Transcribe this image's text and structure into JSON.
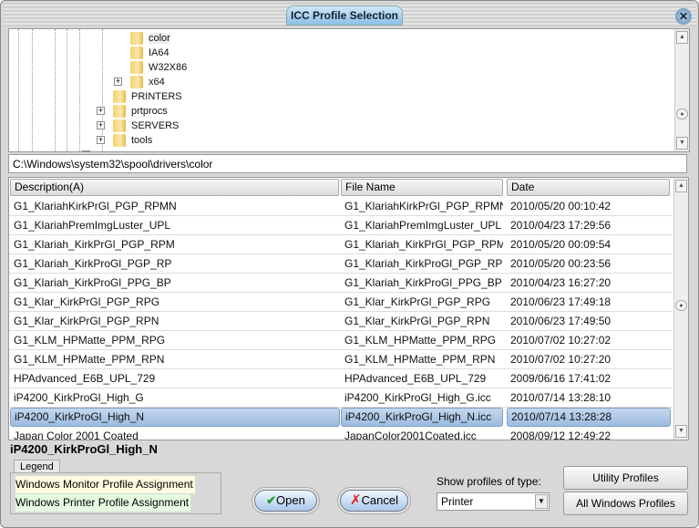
{
  "window": {
    "title": "ICC Profile Selection",
    "close_icon": "close-icon"
  },
  "tree": {
    "items": [
      {
        "label": "color",
        "expandable": false,
        "selected": true
      },
      {
        "label": "IA64",
        "expandable": false
      },
      {
        "label": "W32X86",
        "expandable": false
      },
      {
        "label": "x64",
        "expandable": true
      },
      {
        "label": "PRINTERS",
        "expandable": false
      },
      {
        "label": "prtprocs",
        "expandable": true
      },
      {
        "label": "SERVERS",
        "expandable": true
      },
      {
        "label": "tools",
        "expandable": true
      }
    ]
  },
  "path": "C:\\Windows\\system32\\spool\\drivers\\color",
  "table": {
    "columns": [
      "Description(A)",
      "File Name",
      "Date"
    ],
    "rows": [
      [
        "G1_KlariahKirkPrGl_PGP_RPMN",
        "G1_KlariahKirkPrGl_PGP_RPMN",
        "2010/05/20 00:10:42"
      ],
      [
        "G1_KlariahPremImgLuster_UPL",
        "G1_KlariahPremImgLuster_UPL",
        "2010/04/23 17:29:56"
      ],
      [
        "G1_Klariah_KirkPrGl_PGP_RPM",
        "G1_Klariah_KirkPrGl_PGP_RPM",
        "2010/05/20 00:09:54"
      ],
      [
        "G1_Klariah_KirkProGl_PGP_RP",
        "G1_Klariah_KirkProGl_PGP_RP",
        "2010/05/20 00:23:56"
      ],
      [
        "G1_Klariah_KirkProGl_PPG_BP",
        "G1_Klariah_KirkProGl_PPG_BP",
        "2010/04/23 16:27:20"
      ],
      [
        "G1_Klar_KirkPrGl_PGP_RPG",
        "G1_Klar_KirkPrGl_PGP_RPG",
        "2010/06/23 17:49:18"
      ],
      [
        "G1_Klar_KirkPrGl_PGP_RPN",
        "G1_Klar_KirkPrGl_PGP_RPN",
        "2010/06/23 17:49:50"
      ],
      [
        "G1_KLM_HPMatte_PPM_RPG",
        "G1_KLM_HPMatte_PPM_RPG",
        "2010/07/02 10:27:02"
      ],
      [
        "G1_KLM_HPMatte_PPM_RPN",
        "G1_KLM_HPMatte_PPM_RPN",
        "2010/07/02 10:27:20"
      ],
      [
        "HPAdvanced_E6B_UPL_729",
        "HPAdvanced_E6B_UPL_729",
        "2009/06/16 17:41:02"
      ],
      [
        "iP4200_KirkProGl_High_G",
        "iP4200_KirkProGl_High_G.icc",
        "2010/07/14 13:28:10"
      ],
      [
        "iP4200_KirkProGl_High_N",
        "iP4200_KirkProGl_High_N.icc",
        "2010/07/14 13:28:28"
      ],
      [
        "Japan Color 2001 Coated",
        "JapanColor2001Coated.icc",
        "2008/09/12 12:49:22"
      ]
    ],
    "selected_index": 11
  },
  "selected_name": "iP4200_KirkProGl_High_N",
  "legend": {
    "tab": "Legend",
    "monitor": "Windows Monitor Profile Assignment",
    "printer": "Windows Printer Profile Assignment",
    "monitor_color": "#fffbe0",
    "printer_color": "#e4fbe0"
  },
  "buttons": {
    "open": "Open",
    "cancel": "Cancel",
    "utility": "Utility Profiles",
    "all_windows": "All Windows Profiles"
  },
  "filter": {
    "label": "Show profiles of type:",
    "value": "Printer"
  }
}
